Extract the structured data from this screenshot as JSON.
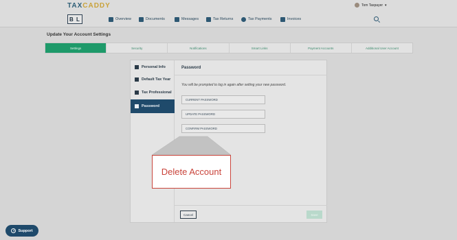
{
  "app": {
    "logo_text": "TAXCADDY",
    "logo_prefix": "TAX",
    "logo_suffix": "CADDY",
    "brand_box": "B L"
  },
  "user": {
    "name": "Tom Taxpayer",
    "caret": "▾"
  },
  "nav": [
    {
      "label": "Overview",
      "icon": "home-icon"
    },
    {
      "label": "Documents",
      "icon": "documents-icon"
    },
    {
      "label": "Messages",
      "icon": "messages-icon"
    },
    {
      "label": "Tax Returns",
      "icon": "tax-returns-icon"
    },
    {
      "label": "Tax Payments",
      "icon": "tax-payments-icon"
    },
    {
      "label": "Invoices",
      "icon": "invoices-icon"
    }
  ],
  "page": {
    "title": "Update Your Account Settings"
  },
  "tabs": [
    {
      "label": "Settings",
      "active": true
    },
    {
      "label": "Security",
      "active": false
    },
    {
      "label": "Notifications",
      "active": false
    },
    {
      "label": "Smart Links",
      "active": false
    },
    {
      "label": "Payment Accounts",
      "active": false
    },
    {
      "label": "Additional User Account",
      "active": false
    }
  ],
  "sidebar": [
    {
      "label": "Personal Info",
      "icon": "person-icon",
      "active": false
    },
    {
      "label": "Default Tax Year",
      "icon": "calendar-icon",
      "active": false
    },
    {
      "label": "Tax Professional",
      "icon": "briefcase-icon",
      "active": false
    },
    {
      "label": "Password",
      "icon": "lock-icon",
      "active": true
    }
  ],
  "content": {
    "title": "Password",
    "message": "You will be prompted to log in again after setting your new password.",
    "fields": [
      {
        "placeholder": "CURRENT PASSWORD"
      },
      {
        "placeholder": "UPDATE PASSWORD"
      },
      {
        "placeholder": "CONFIRM PASSWORD"
      }
    ],
    "delete_label": "Delete Account",
    "cancel_label": "Cancel",
    "save_label": "Save"
  },
  "callout": {
    "label": "Delete Account"
  },
  "support": {
    "label": "Support",
    "icon_glyph": "?"
  },
  "colors": {
    "accent_green": "#1e9a6a",
    "navy": "#1f4a6b",
    "danger": "#c9433a"
  }
}
